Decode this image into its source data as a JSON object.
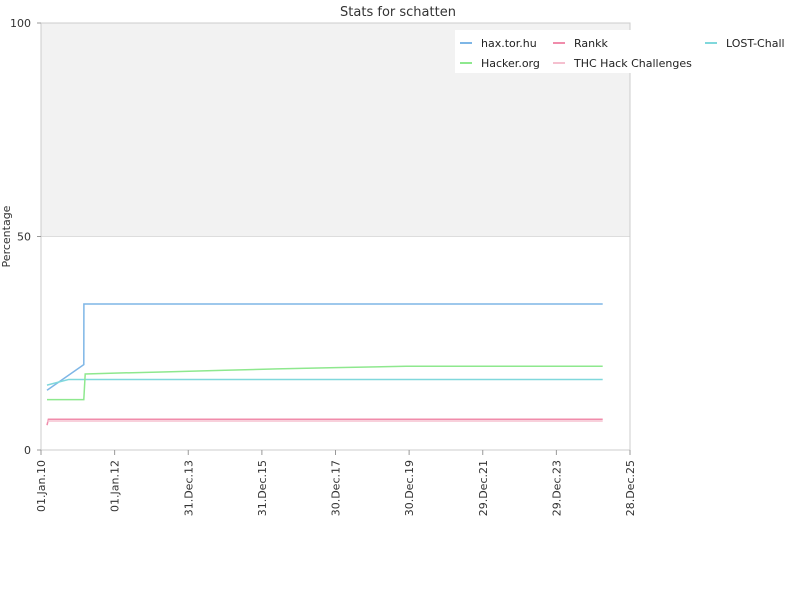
{
  "chart_data": {
    "type": "line",
    "title": "Stats for schatten",
    "xlabel": "",
    "ylabel": "Percentage",
    "ylim": [
      0,
      100
    ],
    "xlim": [
      "2010-01-01",
      "2025-12-28"
    ],
    "y_ticks": [
      "0",
      "50",
      "100"
    ],
    "x_ticks": [
      {
        "date": "2010-01-01",
        "label": "01.Jan.10"
      },
      {
        "date": "2012-01-01",
        "label": "01.Jan.12"
      },
      {
        "date": "2013-12-31",
        "label": "31.Dec.13"
      },
      {
        "date": "2015-12-31",
        "label": "31.Dec.15"
      },
      {
        "date": "2017-12-30",
        "label": "30.Dec.17"
      },
      {
        "date": "2019-12-30",
        "label": "30.Dec.19"
      },
      {
        "date": "2021-12-29",
        "label": "29.Dec.21"
      },
      {
        "date": "2023-12-29",
        "label": "29.Dec.23"
      },
      {
        "date": "2025-12-28",
        "label": "28.Dec.25"
      }
    ],
    "grid": true,
    "legend_position": "top-right",
    "series": [
      {
        "name": "hax.tor.hu",
        "color": "#7eb6e6",
        "points": [
          [
            "2010-03-01",
            14.0
          ],
          [
            "2010-09-01",
            17.0
          ],
          [
            "2011-03-01",
            20.0
          ],
          [
            "2011-03-02",
            34.2
          ],
          [
            "2025-04-01",
            34.2
          ]
        ]
      },
      {
        "name": "Rankk",
        "color": "#f08cab",
        "points": [
          [
            "2010-03-01",
            5.8
          ],
          [
            "2010-03-15",
            7.2
          ],
          [
            "2025-04-01",
            7.2
          ]
        ]
      },
      {
        "name": "LOST-Chall",
        "color": "#80d8dc",
        "points": [
          [
            "2010-03-01",
            15.2
          ],
          [
            "2010-10-01",
            16.5
          ],
          [
            "2025-04-01",
            16.5
          ]
        ]
      },
      {
        "name": "Hacker.org",
        "color": "#8ee88e",
        "points": [
          [
            "2010-03-01",
            11.8
          ],
          [
            "2011-03-01",
            11.8
          ],
          [
            "2011-03-15",
            17.8
          ],
          [
            "2012-01-01",
            18.0
          ],
          [
            "2013-06-01",
            18.3
          ],
          [
            "2015-01-01",
            18.7
          ],
          [
            "2016-06-01",
            19.0
          ],
          [
            "2018-01-01",
            19.3
          ],
          [
            "2019-12-01",
            19.6
          ],
          [
            "2025-04-01",
            19.6
          ]
        ]
      },
      {
        "name": "THC Hack Challenges",
        "color": "#f5c0cf",
        "points": [
          [
            "2010-03-01",
            6.8
          ],
          [
            "2025-04-01",
            6.8
          ]
        ]
      }
    ]
  }
}
